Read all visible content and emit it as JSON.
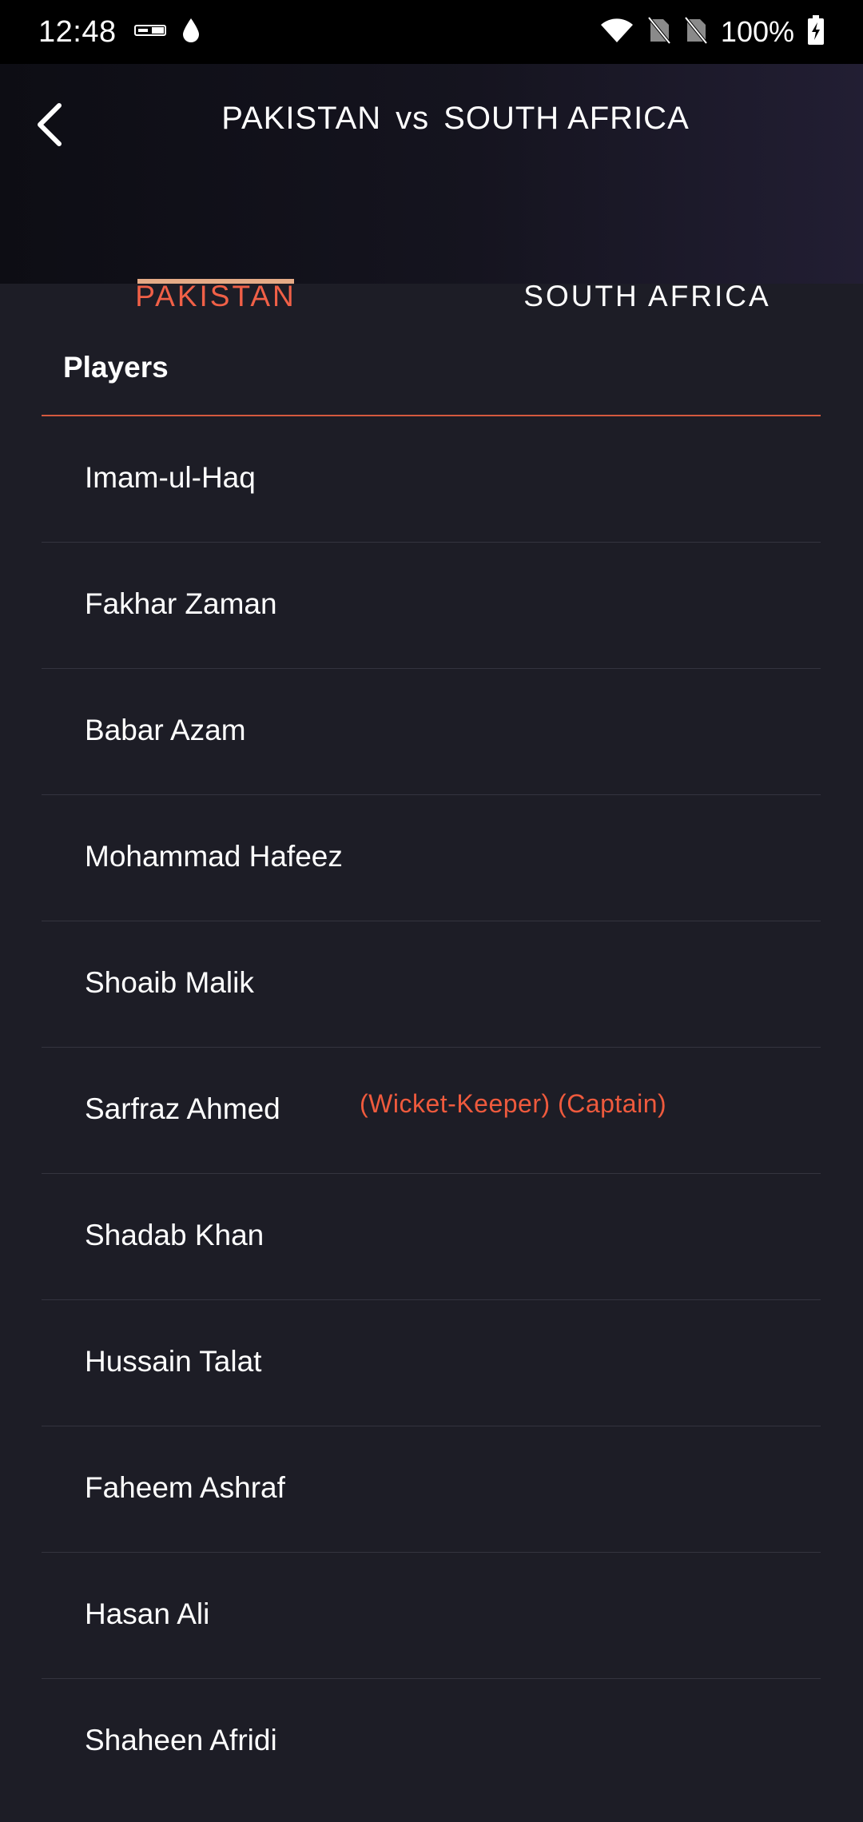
{
  "status_bar": {
    "time": "12:48",
    "battery_percent": "100%",
    "icons": [
      "epic-on-icon",
      "drop-icon",
      "wifi-icon",
      "no-sim-icon",
      "no-sim-icon",
      "battery-charging-icon"
    ]
  },
  "header": {
    "team_a": "PAKISTAN",
    "vs": "vs",
    "team_b": "SOUTH AFRICA",
    "back_icon": "chevron-left-icon"
  },
  "tabs": [
    {
      "label": "PAKISTAN",
      "selected": true
    },
    {
      "label": "SOUTH AFRICA",
      "selected": false
    }
  ],
  "section": {
    "title": "Players"
  },
  "players": [
    {
      "name": "Imam-ul-Haq",
      "tag": ""
    },
    {
      "name": "Fakhar Zaman",
      "tag": ""
    },
    {
      "name": "Babar Azam",
      "tag": ""
    },
    {
      "name": "Mohammad Hafeez",
      "tag": ""
    },
    {
      "name": "Shoaib Malik",
      "tag": ""
    },
    {
      "name": "Sarfraz Ahmed",
      "tag": "(Wicket-Keeper) (Captain)"
    },
    {
      "name": "Shadab Khan",
      "tag": ""
    },
    {
      "name": "Hussain Talat",
      "tag": ""
    },
    {
      "name": "Faheem Ashraf",
      "tag": ""
    },
    {
      "name": "Hasan Ali",
      "tag": ""
    },
    {
      "name": "Shaheen Afridi",
      "tag": ""
    }
  ],
  "colors": {
    "accent": "#f06047",
    "tab_indicator": "#e5ab87",
    "background": "#1d1d26",
    "divider": "#34343f"
  }
}
